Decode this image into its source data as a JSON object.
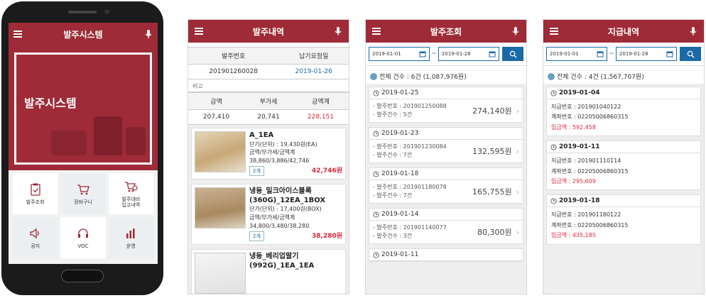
{
  "phone1": {
    "title": "발주시스템",
    "hero_text": "발주시스템",
    "tiles": [
      {
        "label": "발주조회",
        "icon": "clipboard-check-icon"
      },
      {
        "label": "장바구니",
        "icon": "cart-icon"
      },
      {
        "label": "발주대비\n입고내역",
        "icon": "cart-history-icon"
      },
      {
        "label": "공지",
        "icon": "speaker-icon"
      },
      {
        "label": "VOC",
        "icon": "headset-icon"
      },
      {
        "label": "운영",
        "icon": "chart-icon"
      }
    ]
  },
  "screen2": {
    "title": "발주내역",
    "order_header": {
      "col1": "발주번호",
      "col2": "납기요청일"
    },
    "order_row": {
      "order_no": "201901260028",
      "due_date": "2019-01-26"
    },
    "note_label": "비고",
    "amount_header": {
      "col1": "금액",
      "col2": "부가세",
      "col3": "금액계"
    },
    "amount_row": {
      "amount": "207,410",
      "vat": "20,741",
      "total": "228,151"
    },
    "items": [
      {
        "name": "A_1EA",
        "unit": "단기(단위) : 19,430원(EA)",
        "breakdown_label": "금액/부가세/금액계",
        "breakdown": "38,860/3,886/42,746",
        "qty": "2개",
        "amount": "42,746원"
      },
      {
        "name": "냉동_밀크아이스블록(360G)_12EA_1BOX",
        "unit": "단가(단위) : 17,400원(BOX)",
        "breakdown_label": "금액/부가세/금액계",
        "breakdown": "34,800/3,480/38,280",
        "qty": "2개",
        "amount": "38,280원"
      },
      {
        "name": "냉동_베리업딸기(992G)_1EA_1EA",
        "unit": "",
        "breakdown_label": "",
        "breakdown": "",
        "qty": "",
        "amount": ""
      }
    ]
  },
  "screen3": {
    "title": "발주조회",
    "date_from": "2019-01-01",
    "date_to": "2019-01-28",
    "tilde": "~",
    "total": "전체 건수 : 6건 (1,087,976원)",
    "cards": [
      {
        "date": "2019-01-25",
        "order_no": "- 발주번호 : 201901250088",
        "count": "- 발주건수 : 5건",
        "amount": "274,140원"
      },
      {
        "date": "2019-01-23",
        "order_no": "- 발주번호 : 201901230084",
        "count": "- 발주건수 : 7건",
        "amount": "132,595원"
      },
      {
        "date": "2019-01-18",
        "order_no": "- 발주번호 : 201901180078",
        "count": "- 발주건수 : 7건",
        "amount": "165,755원"
      },
      {
        "date": "2019-01-14",
        "order_no": "- 발주번호 : 201901140077",
        "count": "- 발주건수 : 3건",
        "amount": "80,300원"
      },
      {
        "date": "2019-01-11",
        "order_no": "",
        "count": "",
        "amount": ""
      }
    ]
  },
  "screen4": {
    "title": "지급내역",
    "date_from": "2019-01-01",
    "date_to": "2019-01-28",
    "tilde": "~",
    "total": "전체 건수 : 4건 (1,567,707원)",
    "cards": [
      {
        "date": "2019-01-04",
        "pay_no": "지급번호 : 201901040122",
        "account": "계좌번호 : 02205006860315",
        "amount": "입금액 : 592,458"
      },
      {
        "date": "2019-01-11",
        "pay_no": "지급번호 : 201901110114",
        "account": "계좌번호 : 02205006860315",
        "amount": "입금액 : 295,609"
      },
      {
        "date": "2019-01-18",
        "pay_no": "지급번호 : 201901180122",
        "account": "계좌번호 : 02205006860315",
        "amount": "입금액 : 435,185"
      }
    ]
  },
  "colors": {
    "brand": "#9e2b37",
    "accent": "#1a6aa8",
    "negative": "#e0243a"
  }
}
